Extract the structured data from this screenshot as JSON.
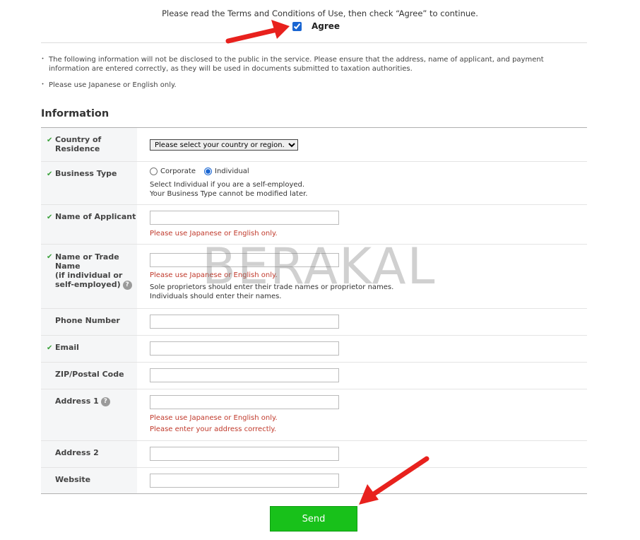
{
  "terms": {
    "text": "Please read the Terms and Conditions of Use, then check “Agree” to continue.",
    "agree_label": "Agree",
    "agree_checked": true
  },
  "notes": [
    "The following information will not be disclosed to the public in the service. Please ensure that the address, name of applicant, and payment information are entered correctly, as they will be used in documents submitted to taxation authorities.",
    "Please use Japanese or English only."
  ],
  "section_title": "Information",
  "fields": {
    "country": {
      "label": "Country of Residence",
      "required": true,
      "selected": "Please select your country or region."
    },
    "business_type": {
      "label": "Business Type",
      "required": true,
      "options": [
        "Corporate",
        "Individual"
      ],
      "selected": "Individual",
      "desc1": "Select Individual if you are a self-employed.",
      "desc2": "Your Business Type cannot be modified later."
    },
    "applicant": {
      "label": "Name of Applicant",
      "required": true,
      "value": "",
      "error": "Please use Japanese or English only."
    },
    "trade_name": {
      "label_line1": "Name or Trade Name",
      "label_line2": "(if individual or self-employed)",
      "required": true,
      "value": "",
      "error": "Please use Japanese or English only.",
      "desc1": "Sole proprietors should enter their trade names or proprietor names.",
      "desc2": "Individuals should enter their names."
    },
    "phone": {
      "label": "Phone Number",
      "required": false,
      "value": ""
    },
    "email": {
      "label": "Email",
      "required": true,
      "value": ""
    },
    "zip": {
      "label": "ZIP/Postal Code",
      "required": false,
      "value": ""
    },
    "address1": {
      "label": "Address 1",
      "required": false,
      "value": "",
      "error1": "Please use Japanese or English only.",
      "error2": "Please enter your address correctly."
    },
    "address2": {
      "label": "Address 2",
      "required": false,
      "value": ""
    },
    "website": {
      "label": "Website",
      "required": false,
      "value": ""
    }
  },
  "send_label": "Send",
  "watermark": "BERAKAL",
  "colors": {
    "send": "#18c11a",
    "error": "#c0392b",
    "check": "#3aa13a",
    "arrow": "#e8211d"
  }
}
